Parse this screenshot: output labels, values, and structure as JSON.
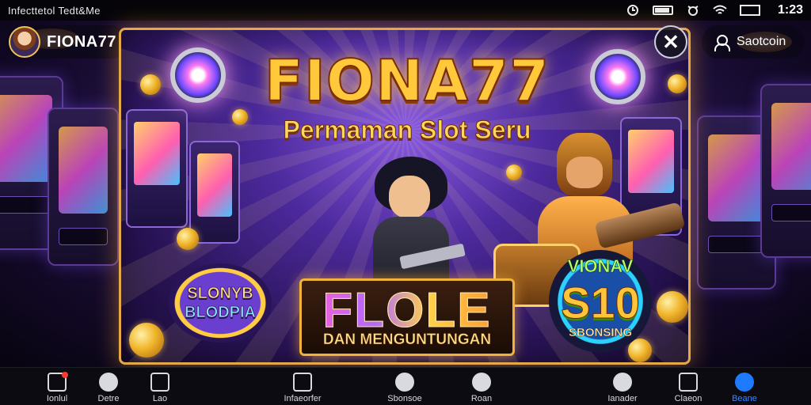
{
  "status_bar": {
    "title": "Infecttetol Tedt&Me",
    "time": "1:23",
    "icons": [
      "sync-icon",
      "battery-icon",
      "alarm-icon",
      "wifi-icon",
      "screen-icon"
    ]
  },
  "header": {
    "profile_name": "FIONA77",
    "signin_label": "Saotcoin"
  },
  "promo": {
    "title": "FIONA77",
    "subtitle": "Permaman Slot Seru",
    "left_badge": {
      "line1": "SLONYB",
      "line2": "BLODPIA"
    },
    "center_plate": {
      "word": "FLOLE",
      "subtitle": "DAN MENGUNTUNGAN"
    },
    "right_badge": {
      "top": "VIONAV",
      "amount": "S10",
      "bottom": "SBONSING"
    },
    "close_label": "✕"
  },
  "bottom_nav": {
    "items": [
      {
        "label": "Ionlul",
        "icon": "wallet-icon",
        "badge": true
      },
      {
        "label": "Detre",
        "icon": "game-icon"
      },
      {
        "label": "Lao",
        "icon": "tablet-icon"
      },
      {
        "label": "Infaeorfer",
        "icon": "store-icon"
      },
      {
        "label": "Sbonsoe",
        "icon": "emoji-icon"
      },
      {
        "label": "Roan",
        "icon": "record-icon"
      },
      {
        "label": "Ianader",
        "icon": "profile-icon"
      },
      {
        "label": "Claeon",
        "icon": "chat-icon"
      },
      {
        "label": "Beane",
        "icon": "home-icon",
        "active": true
      }
    ]
  },
  "colors": {
    "accent": "#e3a949",
    "active_nav": "#1e7bff",
    "background": "#0a0716"
  }
}
